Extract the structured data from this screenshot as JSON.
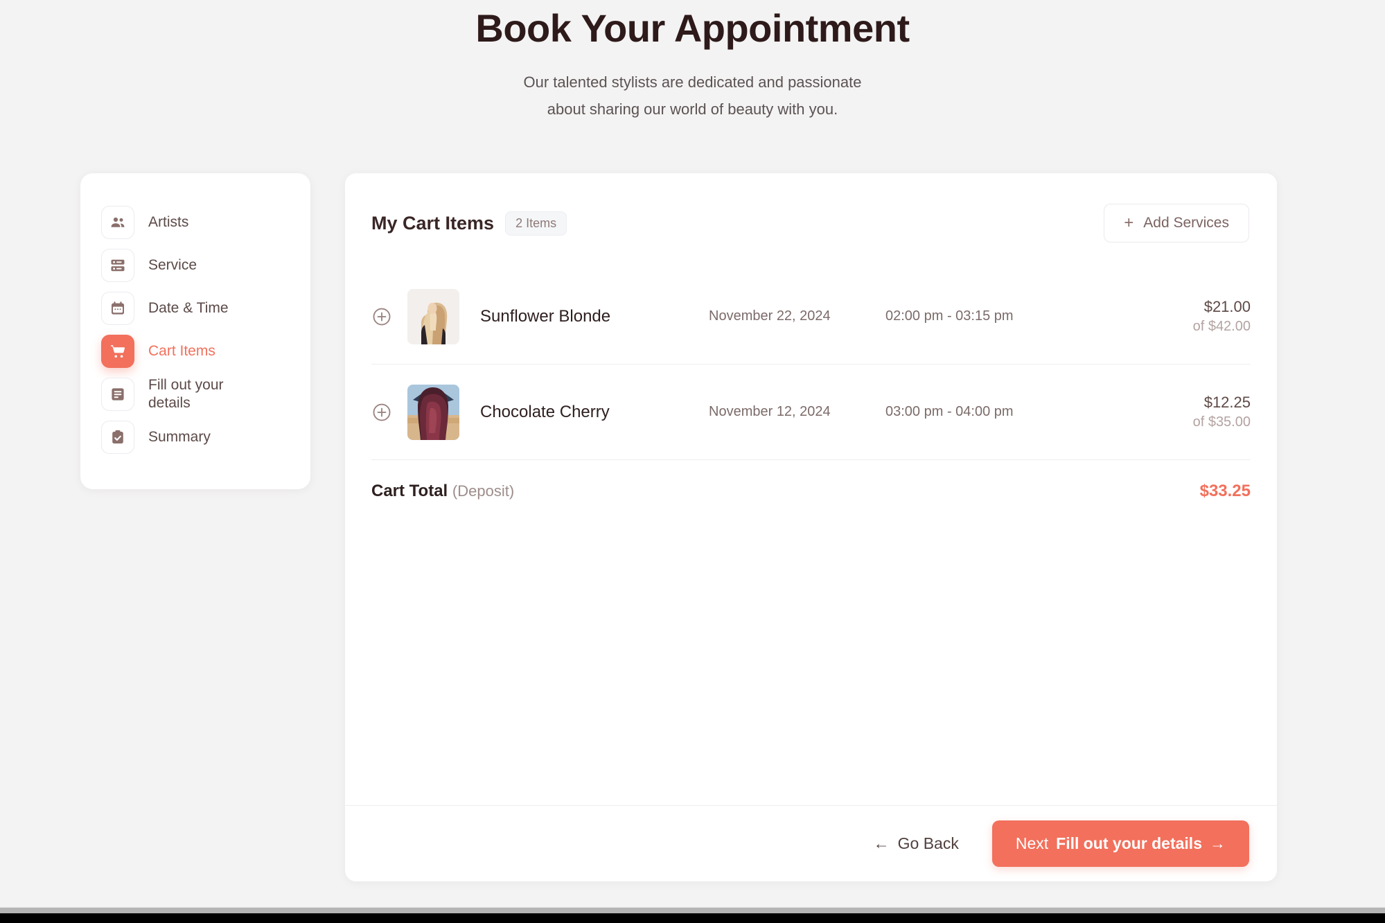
{
  "header": {
    "title": "Book Your Appointment",
    "subtitle_line1": "Our talented stylists are dedicated and passionate",
    "subtitle_line2": "about sharing our world of beauty with you."
  },
  "theme": {
    "accent": "#f2705c",
    "page_background": "#f4f3f3",
    "card_background": "#ffffff",
    "title_color": "#2e1a1a",
    "muted_text": "#7b6b69"
  },
  "sidebar": {
    "items": [
      {
        "label": "Artists",
        "icon": "people-icon",
        "active": false
      },
      {
        "label": "Service",
        "icon": "list-icon",
        "active": false
      },
      {
        "label": "Date & Time",
        "icon": "calendar-icon",
        "active": false
      },
      {
        "label": "Cart Items",
        "icon": "cart-icon",
        "active": true
      },
      {
        "label": "Fill out your details",
        "icon": "form-icon",
        "active": false
      },
      {
        "label": "Summary",
        "icon": "clipboard-check-icon",
        "active": false
      }
    ]
  },
  "cart": {
    "title": "My Cart Items",
    "count_badge": "2 Items",
    "add_services_label": "Add Services",
    "add_services_icon": "plus-icon",
    "rows": [
      {
        "expand_icon": "plus-circle-icon",
        "thumb": "blonde-hair-photo",
        "name": "Sunflower Blonde",
        "date": "November 22, 2024",
        "time": "02:00 pm - 03:15 pm",
        "price_main": "$21.00",
        "price_sub": "of $42.00"
      },
      {
        "expand_icon": "plus-circle-icon",
        "thumb": "cherry-hair-photo",
        "name": "Chocolate Cherry",
        "date": "November 12, 2024",
        "time": "03:00 pm - 04:00 pm",
        "price_main": "$12.25",
        "price_sub": "of $35.00"
      }
    ],
    "total_label": "Cart Total",
    "total_note": "(Deposit)",
    "total_value": "$33.25"
  },
  "footer": {
    "back_label": "Go Back",
    "back_arrow": "←",
    "next_prefix": "Next",
    "next_label": "Fill out your details",
    "next_arrow": "→"
  }
}
